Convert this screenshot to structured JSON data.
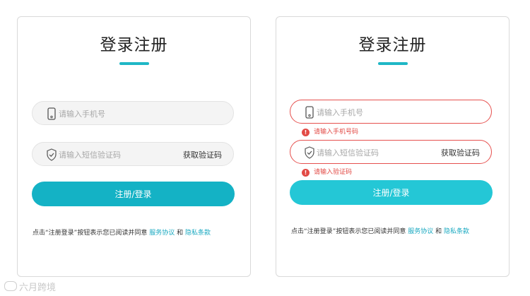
{
  "left_card": {
    "title": "登录注册",
    "phone_placeholder": "请输入手机号",
    "code_placeholder": "请输入短信验证码",
    "get_code_label": "获取验证码",
    "submit_label": "注册/登录",
    "agree_prefix": "点击“注册登录”按钮表示您已阅读并同意",
    "service_link": "服务协议",
    "and_text": "和",
    "privacy_link": "隐私条款"
  },
  "right_card": {
    "title": "登录注册",
    "phone_placeholder": "请输入手机号",
    "phone_error": "请输入手机号码",
    "code_placeholder": "请输入短信验证码",
    "code_error": "请输入验证码",
    "get_code_label": "获取验证码",
    "submit_label": "注册/登录",
    "agree_prefix": "点击“注册登录”按钮表示您已阅读并同意",
    "service_link": "服务协议",
    "and_text": "和",
    "privacy_link": "隐私条款"
  },
  "colors": {
    "accent": "#1fb7c6",
    "error": "#e24a45",
    "button": "#14b2c5"
  },
  "watermark": "六月跨境"
}
